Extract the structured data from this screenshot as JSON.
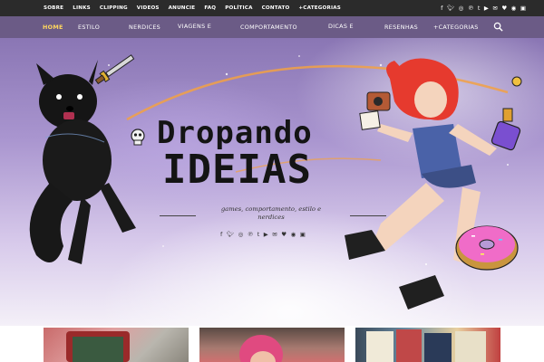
{
  "topbar": {
    "links": [
      "SOBRE",
      "LINKS",
      "CLIPPING",
      "VIDEOS",
      "ANUNCIE",
      "FAQ",
      "POLÍTICA",
      "CONTATO",
      "+CATEGORIAS"
    ],
    "social_icons": [
      "facebook-icon",
      "twitter-icon",
      "instagram-icon",
      "pinterest-icon",
      "tumblr-icon",
      "youtube-icon",
      "email-icon",
      "heart-icon",
      "spotify-icon",
      "twitch-icon"
    ]
  },
  "mainnav": {
    "items": [
      "HOME",
      "ESTILO",
      "NERDICES",
      "VIAGENS E EVENTOS",
      "COMPORTAMENTO",
      "DICAS E TUTORIAIS",
      "RESENHAS",
      "+CATEGORIAS"
    ],
    "active": "HOME",
    "accent_color": "#ffd75e",
    "background_color": "#6b5b86"
  },
  "hero": {
    "title_line1": "Dropando",
    "title_line2": "IDEIAS",
    "tagline": "games, comportamento, estilo e nerdices",
    "social_icons": [
      "facebook-icon",
      "twitter-icon",
      "instagram-icon",
      "pinterest-icon",
      "tumblr-icon",
      "youtube-icon",
      "email-icon",
      "heart-icon",
      "spotify-icon",
      "twitch-icon"
    ]
  },
  "cards": [
    "nintendo-3ds-photo",
    "person-pink-hair-photo",
    "books-photo"
  ]
}
